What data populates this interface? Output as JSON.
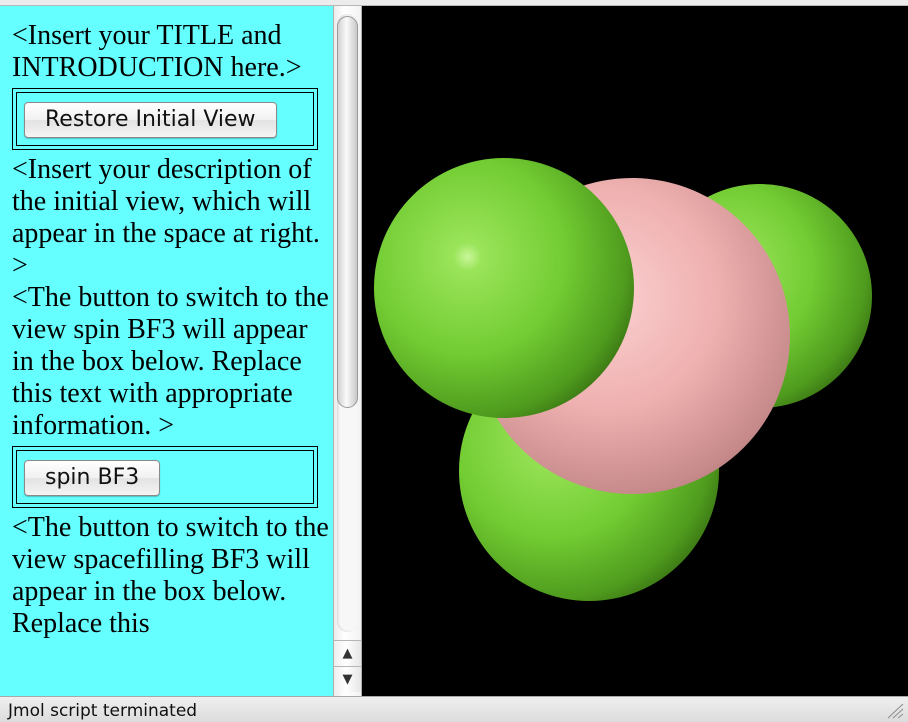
{
  "left_panel": {
    "background_color": "#66ffff",
    "intro_text": "<Insert your TITLE and INTRODUCTION here.>",
    "restore_button_label": "Restore Initial View",
    "initial_view_description": "<Insert your description of the initial view, which will appear in the space at right. >",
    "spin_instructions": "<The button to switch to the view spin BF3 will appear in the box below. Replace this text with appropriate information. >",
    "spin_button_label": "spin BF3",
    "spacefilling_instructions": "<The button to switch to the view spacefilling BF3 will appear in the box below. Replace this"
  },
  "scrollbar": {
    "up_arrow_icon": "arrow-up-icon",
    "down_arrow_icon": "arrow-down-icon"
  },
  "viewer": {
    "background_color": "#000000",
    "molecule": "BF3",
    "atoms": [
      {
        "element": "F",
        "color": "#7ed63a"
      },
      {
        "element": "F",
        "color": "#7ed63a"
      },
      {
        "element": "F",
        "color": "#7ed63a"
      },
      {
        "element": "B",
        "color": "#f2b5b5"
      }
    ]
  },
  "status_bar": {
    "text": "Jmol script terminated",
    "resize_icon": "resize-grip-icon"
  }
}
